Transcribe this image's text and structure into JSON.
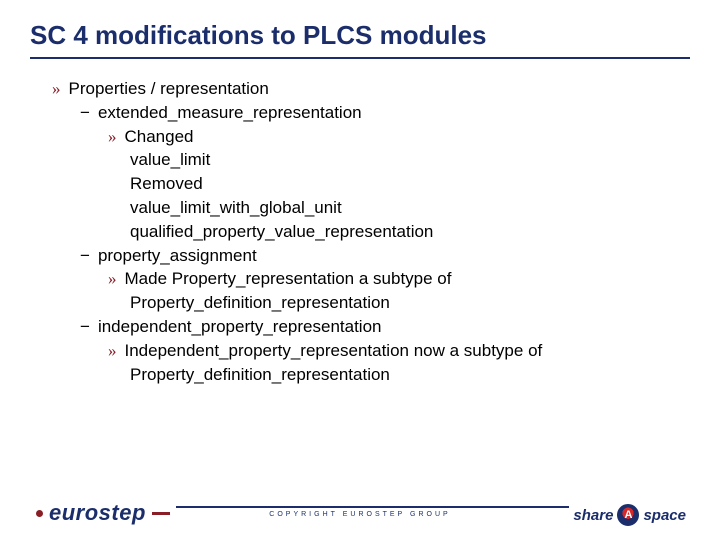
{
  "title": "SC 4 modifications to PLCS modules",
  "content": {
    "l1": "Properties / representation",
    "sub1": "extended_measure_representation",
    "sub1_l3": "Changed",
    "sub1_a": "value_limit",
    "sub1_b": "Removed",
    "sub1_c": "value_limit_with_global_unit",
    "sub1_d": "qualified_property_value_representation",
    "sub2": "property_assignment",
    "sub2_l3a": "Made Property_representation a subtype of",
    "sub2_l3b": "Property_definition_representation",
    "sub3": "independent_property_representation",
    "sub3_l3a": "Independent_property_representation now a subtype of",
    "sub3_l3b": "Property_definition_representation"
  },
  "footer": {
    "logo_left": "eurostep",
    "copyright": "COPYRIGHT EUROSTEP GROUP",
    "logo_right_1": "share",
    "logo_right_a": "A",
    "logo_right_2": "space"
  }
}
